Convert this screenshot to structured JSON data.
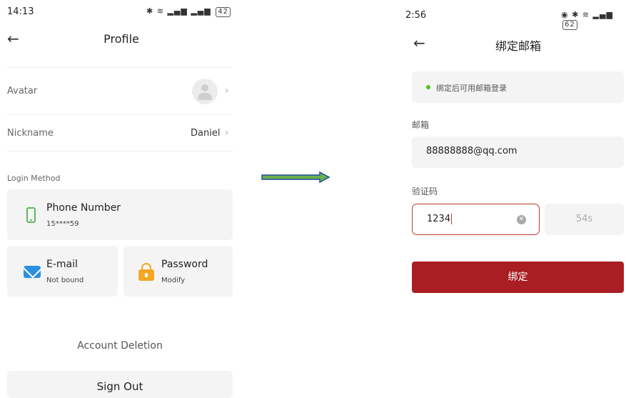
{
  "left": {
    "status_time": "14:13",
    "status_battery": "42",
    "title": "Profile",
    "avatar_label": "Avatar",
    "nickname_label": "Nickname",
    "nickname_value": "Daniel",
    "login_method_label": "Login Method",
    "phone_card": {
      "title": "Phone Number",
      "sub": "15****59",
      "icon": "phone-icon"
    },
    "email_card": {
      "title": "E-mail",
      "sub": "Not bound",
      "icon": "mail-icon"
    },
    "password_card": {
      "title": "Password",
      "sub": "Modify",
      "icon": "lock-icon"
    },
    "account_deletion": "Account Deletion",
    "sign_out": "Sign Out"
  },
  "arrow": {
    "fill": "#6ab04c",
    "stroke": "#1f4e9c"
  },
  "right": {
    "status_time": "2:56",
    "status_battery": "62",
    "title": "绑定邮箱",
    "hint": "绑定后可用邮箱登录",
    "email_label": "邮箱",
    "email_value": "88888888@qq.com",
    "code_label": "验证码",
    "code_value": "1234",
    "countdown": "54s",
    "submit": "绑定",
    "accent": "#a91e22"
  }
}
